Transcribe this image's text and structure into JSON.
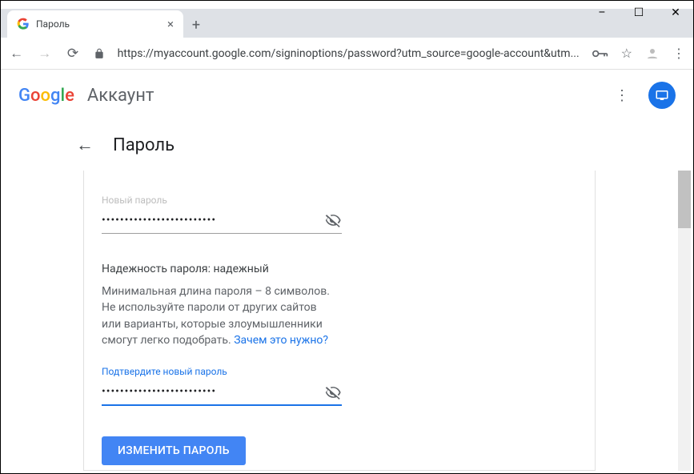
{
  "window": {
    "min": "–",
    "max": "☐",
    "close": "✕"
  },
  "tab": {
    "title": "Пароль"
  },
  "addr": {
    "url": "https://myaccount.google.com/signinoptions/password?utm_source=google-account&utm..."
  },
  "header": {
    "account": "Аккаунт"
  },
  "page": {
    "title": "Пароль"
  },
  "field1": {
    "label": "Новый пароль",
    "value": "•••••••••••••••••••••••••"
  },
  "strength": {
    "label": "Надежность пароля:",
    "value": "надежный"
  },
  "desc": {
    "l1": "Минимальная длина пароля – 8 символов.",
    "l2": "Не используйте пароли от других сайтов или варианты, которые злоумышленники смогут легко подобрать.",
    "link": "Зачем это нужно?"
  },
  "field2": {
    "label": "Подтвердите новый пароль",
    "value": "•••••••••••••••••••••••••"
  },
  "submit": {
    "label": "ИЗМЕНИТЬ ПАРОЛЬ"
  }
}
